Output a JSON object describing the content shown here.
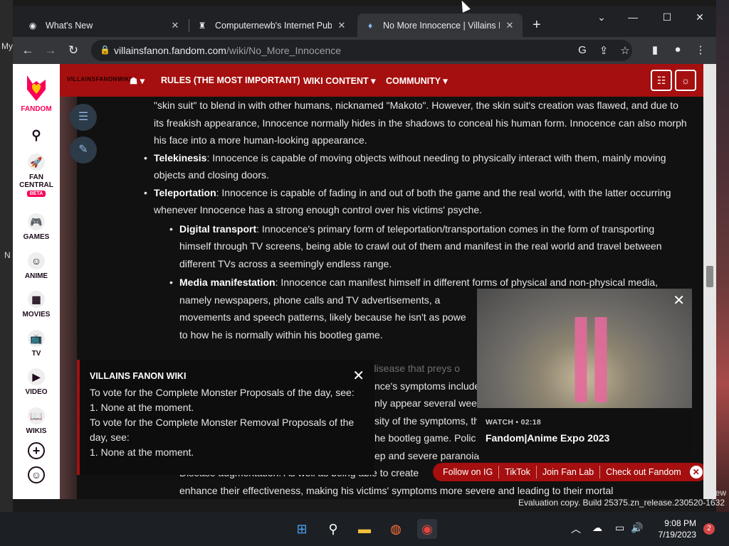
{
  "desktop": {
    "left_labels": [
      "My",
      "N"
    ],
    "right_label": "ew",
    "eval_text": "Evaluation copy. Build 25375.zn_release.230520-1632"
  },
  "browser": {
    "tabs": [
      {
        "title": "What's New",
        "icon": "chrome-icon"
      },
      {
        "title": "Computernewb's Internet Pub H",
        "icon": "pub-icon"
      },
      {
        "title": "No More Innocence | Villains Fan",
        "icon": "fandom-icon"
      }
    ],
    "new_tab": "+",
    "window_controls": [
      "⌄",
      "—",
      "☐",
      "✕"
    ],
    "url_host": "villainsfanon.fandom.com",
    "url_path": "/wiki/No_More_Innocence"
  },
  "fandom_rail": {
    "brand": "FANDOM",
    "items": [
      {
        "label": "FAN CENTRAL",
        "badge": "BETA",
        "icon": "rocket-icon"
      },
      {
        "label": "GAMES",
        "icon": "gamepad-icon"
      },
      {
        "label": "ANIME",
        "icon": "anime-icon"
      },
      {
        "label": "MOVIES",
        "icon": "movies-icon"
      },
      {
        "label": "TV",
        "icon": "tv-icon"
      },
      {
        "label": "VIDEO",
        "icon": "video-icon"
      },
      {
        "label": "WIKIS",
        "icon": "book-icon"
      }
    ]
  },
  "wiki_nav": {
    "logo_text": "VILLAINSFANONWIKI",
    "explore": "▾",
    "links": [
      "RULES (THE MOST IMPORTANT)",
      "WIKI CONTENT",
      "COMMUNITY"
    ]
  },
  "article": {
    "intro": "\"skin suit\" to blend in with other humans, nicknamed \"Makoto\". However, the skin suit's creation was flawed, and due to its freakish appearance, Innocence normally hides in the shadows to conceal his human form. Innocence can also morph his face into a more human-looking appearance.",
    "items": [
      {
        "term": "Telekinesis",
        "text": ": Innocence is capable of moving objects without needing to physically interact with them, mainly moving objects and closing doors."
      },
      {
        "term": "Teleportation",
        "text": ": Innocence is capable of fading in and out of both the game and the real world, with the latter occurring whenever Innocence has a strong enough control over his victims' psyche."
      }
    ],
    "subitems": [
      {
        "term": "Digital transport",
        "text": ": Innocence's primary form of teleportation/transportation comes in the form of transporting himself through TV screens, being able to crawl out of them and manifest in the real world and travel between different TVs across a seemingly endless range."
      },
      {
        "term": "Media manifestation",
        "text": ": Innocence can manifest himself in different forms of physical and non-physical media, namely newspapers, phone calls and TV advertisements, a"
      },
      {
        "text": "movements and speech patterns, likely because he isn't as powe"
      },
      {
        "text": "to how he is normally within his bootleg game."
      }
    ],
    "partial_lines": [
      "Virokinesis: Innocence can infect his victims with disease that preys o",
      "nce's symptoms include",
      "nly appear several wee",
      "sity of the symptoms, th",
      "he bootleg game. Polic",
      "ep and severe paranoia",
      "Disease augmentation: As well as being able to create",
      "enhance their effectiveness, making his victims' symptoms more severe and leading to their mortal"
    ]
  },
  "notice": {
    "title": "VILLAINS FANON WIKI",
    "lines": [
      "To vote for the Complete Monster Proposals of the day, see:",
      "1. None at the moment.",
      "To vote for the Complete Monster Removal Proposals of the",
      "day, see:",
      "1. None at the moment."
    ]
  },
  "video": {
    "watch": "WATCH • 02:18",
    "title": "Fandom|Anime Expo 2023"
  },
  "pills": [
    "Follow on IG",
    "TikTok",
    "Join Fan Lab",
    "Check out Fandom"
  ],
  "taskbar": {
    "time": "9:08 PM",
    "date": "7/19/2023",
    "notifications": "2"
  }
}
